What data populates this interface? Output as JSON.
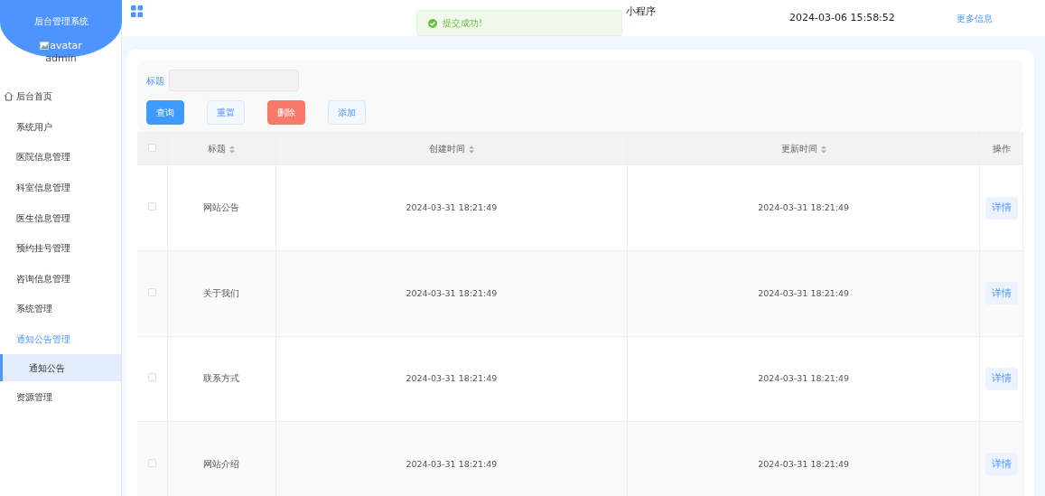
{
  "sidebar": {
    "title": "后台管理系统",
    "avatar_alt": "avatar",
    "username": "admin",
    "items": [
      {
        "label": "后台首页",
        "kind": "home",
        "selected": false
      },
      {
        "label": "系统用户",
        "kind": "menu",
        "selected": false
      },
      {
        "label": "医院信息管理",
        "kind": "menu",
        "selected": false
      },
      {
        "label": "科室信息管理",
        "kind": "menu",
        "selected": false
      },
      {
        "label": "医生信息管理",
        "kind": "menu",
        "selected": false
      },
      {
        "label": "预约挂号管理",
        "kind": "menu",
        "selected": false
      },
      {
        "label": "咨询信息管理",
        "kind": "menu",
        "selected": false
      },
      {
        "label": "系统管理",
        "kind": "menu",
        "selected": false
      },
      {
        "label": "通知公告管理",
        "kind": "menu",
        "selected": true,
        "children": [
          {
            "label": "通知公告",
            "selected": true
          }
        ]
      },
      {
        "label": "资源管理",
        "kind": "menu",
        "selected": false
      }
    ]
  },
  "header": {
    "title": "小程序",
    "datetime": "2024-03-06 15:58:52",
    "more": "更多信息"
  },
  "toast": {
    "message": "提交成功!"
  },
  "search": {
    "label": "标题"
  },
  "buttons": [
    {
      "label": "查询",
      "kind": "primary"
    },
    {
      "label": "重置",
      "kind": "plain"
    },
    {
      "label": "删除",
      "kind": "danger"
    },
    {
      "label": "添加",
      "kind": "plain"
    }
  ],
  "table": {
    "select_all": {
      "checked": false
    },
    "columns": [
      {
        "label": "标题",
        "sortable": true
      },
      {
        "label": "创建时间",
        "sortable": true
      },
      {
        "label": "更新时间",
        "sortable": true
      },
      {
        "label": "操作",
        "sortable": false
      }
    ],
    "rows": [
      {
        "checked": false,
        "title": "网站公告",
        "created": "2024-03-31 18:21:49",
        "updated": "2024-03-31 18:21:49",
        "action": "详情"
      },
      {
        "checked": false,
        "title": "关于我们",
        "created": "2024-03-31 18:21:49",
        "updated": "2024-03-31 18:21:49",
        "action": "详情"
      },
      {
        "checked": false,
        "title": "联系方式",
        "created": "2024-03-31 18:21:49",
        "updated": "2024-03-31 18:21:49",
        "action": "详情"
      },
      {
        "checked": false,
        "title": "网站介绍",
        "created": "2024-03-31 18:21:49",
        "updated": "2024-03-31 18:21:49",
        "action": "详情"
      }
    ]
  }
}
